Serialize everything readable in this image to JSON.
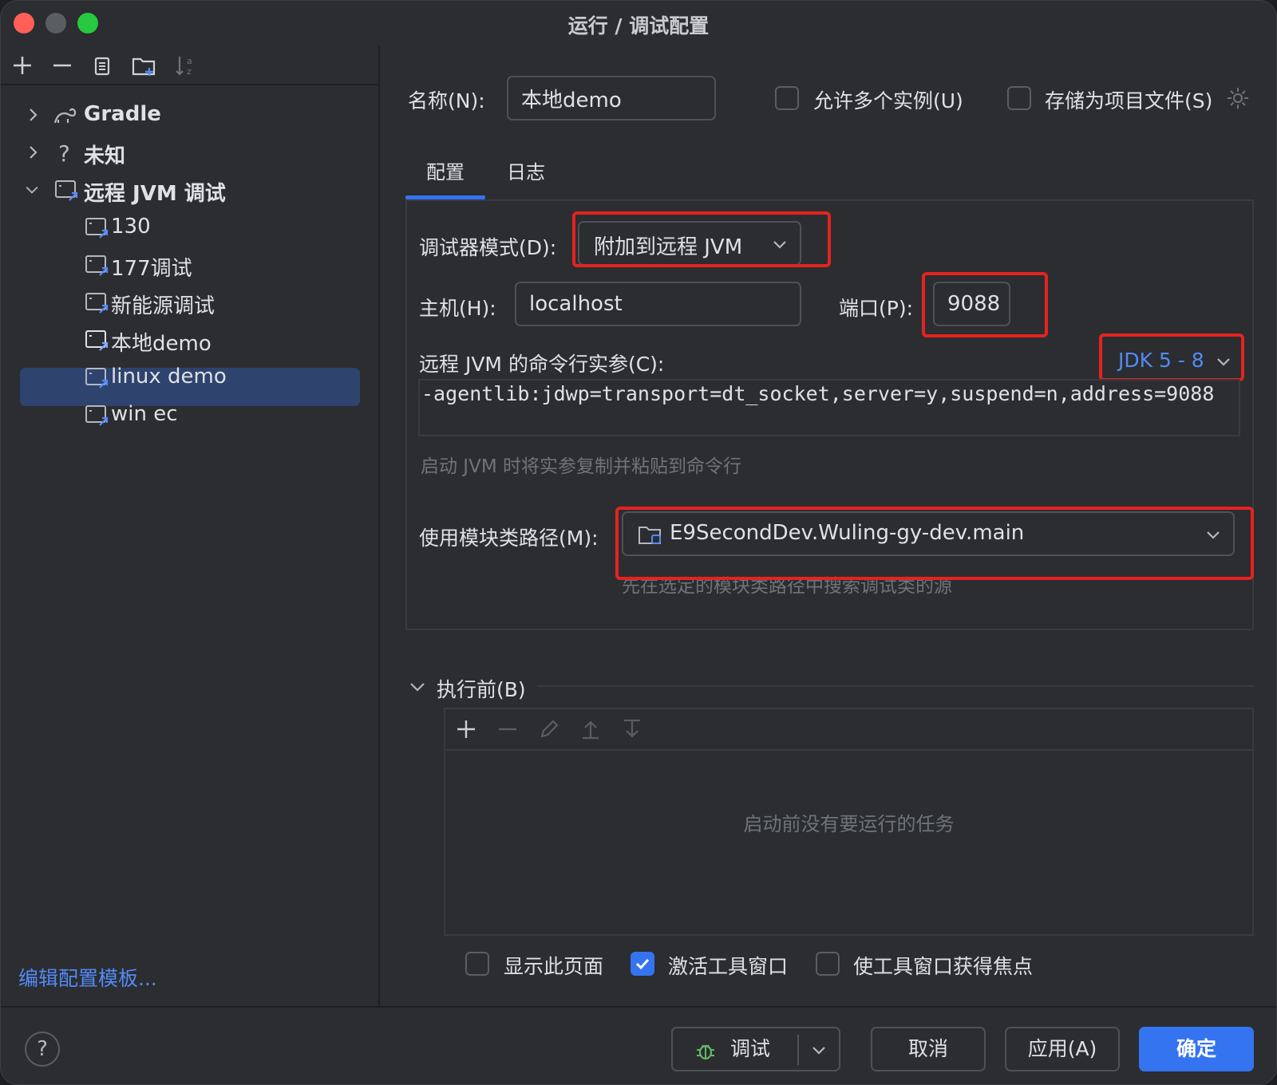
{
  "window": {
    "title": "运行 / 调试配置"
  },
  "tree": {
    "items": [
      {
        "label": "Gradle",
        "icon": "gradle-icon"
      },
      {
        "label": "未知",
        "icon": "question-icon"
      },
      {
        "label": "远程 JVM 调试",
        "icon": "remote-jvm-icon"
      },
      {
        "label": "130"
      },
      {
        "label": "177调试"
      },
      {
        "label": "新能源调试"
      },
      {
        "label": "本地demo"
      },
      {
        "label": "linux demo"
      },
      {
        "label": "win ec"
      }
    ],
    "selected": "本地demo"
  },
  "left_footer": {
    "edit_templates": "编辑配置模板..."
  },
  "form": {
    "name_label": "名称(N):",
    "name_value": "本地demo",
    "allow_multiple_label": "允许多个实例(U)",
    "store_as_file_label": "存储为项目文件(S)"
  },
  "tabs": [
    {
      "label": "配置"
    },
    {
      "label": "日志"
    }
  ],
  "config": {
    "debugger_mode_label": "调试器模式(D):",
    "debugger_mode_value": "附加到远程 JVM",
    "host_label": "主机(H):",
    "host_value": "localhost",
    "port_label": "端口(P):",
    "port_value": "9088",
    "cmd_label": "远程 JVM 的命令行实参(C):",
    "jdk_selector": "JDK 5 - 8",
    "cmd_value": "-agentlib:jdwp=transport=dt_socket,server=y,suspend=n,address=9088",
    "cmd_hint": "启动 JVM 时将实参复制并粘贴到命令行",
    "module_label": "使用模块类路径(M):",
    "module_value": "E9SecondDev.Wuling-gy-dev.main",
    "module_hint": "先在选定的模块类路径中搜索调试类的源"
  },
  "before_launch": {
    "title": "执行前(B)",
    "empty_text": "启动前没有要运行的任务"
  },
  "options": {
    "show_page_label": "显示此页面",
    "show_page_checked": false,
    "activate_tool_label": "激活工具窗口",
    "activate_tool_checked": true,
    "focus_tool_label": "使工具窗口获得焦点",
    "focus_tool_checked": false
  },
  "buttons": {
    "debug": "调试",
    "cancel": "取消",
    "apply": "应用(A)",
    "ok": "确定",
    "help": "?"
  },
  "colors": {
    "accent": "#3574f0",
    "highlight_red": "#e5231f",
    "link": "#548af7",
    "selection": "#2e436e"
  }
}
